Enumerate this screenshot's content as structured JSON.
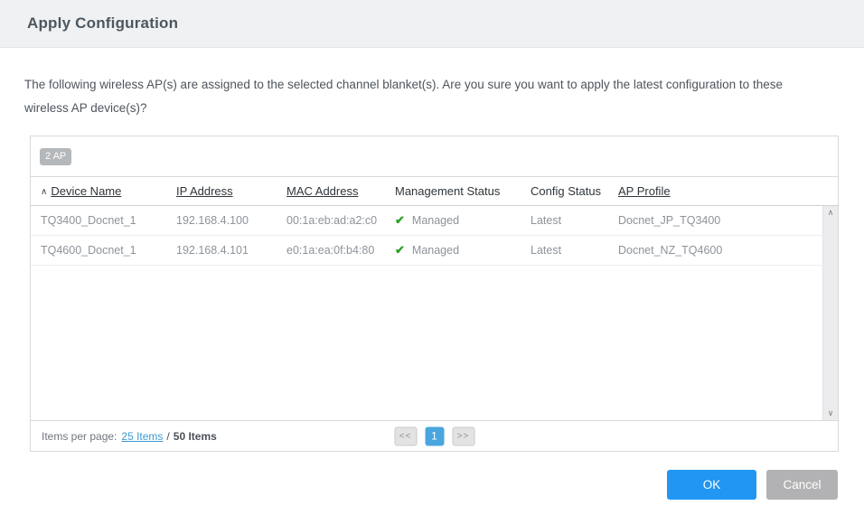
{
  "dialog": {
    "title": "Apply Configuration",
    "message": "The following wireless AP(s) are assigned to the selected channel blanket(s). Are you sure you want to apply the latest configuration to these wireless AP device(s)?"
  },
  "icons": {
    "sort_asc": "∧",
    "check": "✔",
    "scroll_up": "∧",
    "scroll_down": "∨"
  },
  "table": {
    "count_badge": "2 AP",
    "columns": {
      "device_name": "Device Name",
      "ip_address": "IP Address",
      "mac_address": "MAC Address",
      "management_status": "Management Status",
      "config_status": "Config Status",
      "ap_profile": "AP Profile"
    },
    "rows": [
      {
        "device_name": "TQ3400_Docnet_1",
        "ip_address": "192.168.4.100",
        "mac_address": "00:1a:eb:ad:a2:c0",
        "management_status": "Managed",
        "config_status": "Latest",
        "ap_profile": "Docnet_JP_TQ3400"
      },
      {
        "device_name": "TQ4600_Docnet_1",
        "ip_address": "192.168.4.101",
        "mac_address": "e0:1a:ea:0f:b4:80",
        "management_status": "Managed",
        "config_status": "Latest",
        "ap_profile": "Docnet_NZ_TQ4600"
      }
    ]
  },
  "footer": {
    "items_per_page_label": "Items per page:",
    "page_size_link": "25 Items",
    "separator": "/",
    "total_items": "50 Items",
    "pagination": {
      "first": "<<",
      "current_page": "1",
      "last": ">>"
    }
  },
  "buttons": {
    "ok": "OK",
    "cancel": "Cancel"
  },
  "colors": {
    "accent_blue": "#2196f3",
    "pagination_active_blue": "#4aa5de",
    "link_blue": "#3d9ad1",
    "status_green": "#2da12a",
    "cancel_gray": "#b2b2b4",
    "badge_gray": "#b4b8bb",
    "header_bg": "#eff1f3"
  }
}
